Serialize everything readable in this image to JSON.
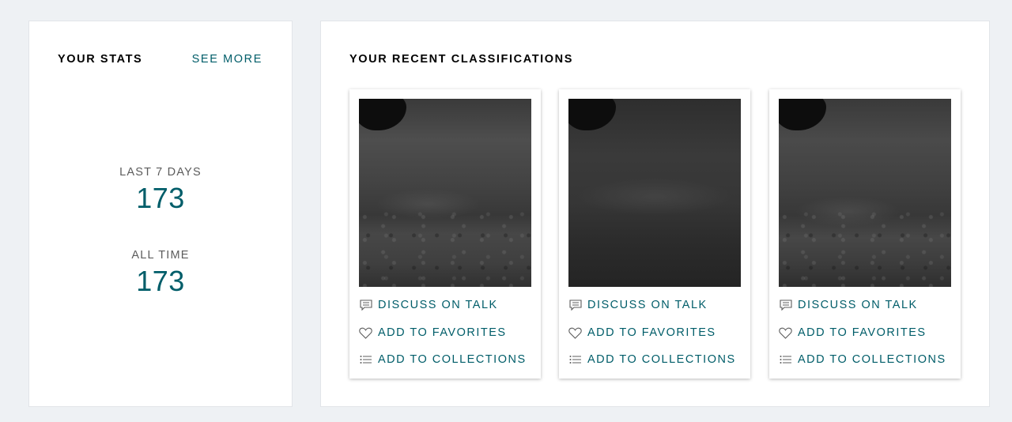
{
  "stats": {
    "heading": "YOUR STATS",
    "see_more": "SEE MORE",
    "last_7_days_label": "LAST 7 DAYS",
    "last_7_days_value": "173",
    "all_time_label": "ALL TIME",
    "all_time_value": "173"
  },
  "recent": {
    "heading": "YOUR RECENT CLASSIFICATIONS",
    "cards": [
      {
        "image_icon": "underwater-seafloor-photo",
        "discuss_label": "DISCUSS ON TALK",
        "favorite_label": "ADD TO FAVORITES",
        "collection_label": "ADD TO COLLECTIONS"
      },
      {
        "image_icon": "underwater-seafloor-photo",
        "discuss_label": "DISCUSS ON TALK",
        "favorite_label": "ADD TO FAVORITES",
        "collection_label": "ADD TO COLLECTIONS"
      },
      {
        "image_icon": "underwater-seafloor-photo",
        "discuss_label": "DISCUSS ON TALK",
        "favorite_label": "ADD TO FAVORITES",
        "collection_label": "ADD TO COLLECTIONS"
      }
    ]
  },
  "icons": {
    "discuss": "speech-bubble-icon",
    "favorite": "heart-icon",
    "collection": "list-icon"
  },
  "colors": {
    "background": "#eef1f4",
    "accent": "#005d69",
    "heading": "#000000",
    "label": "#5c5c5c"
  }
}
